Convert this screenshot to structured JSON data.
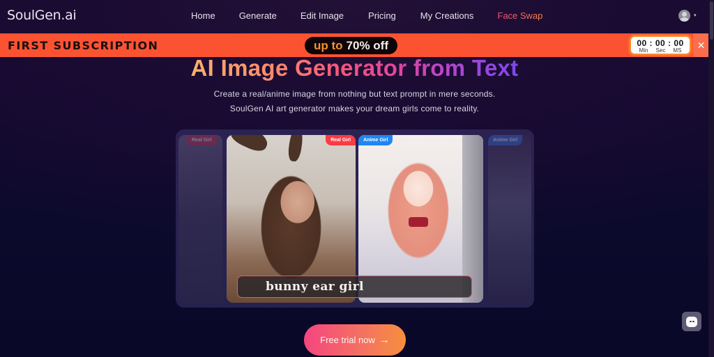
{
  "header": {
    "logo": "SoulGen.ai",
    "nav": [
      {
        "label": "Home"
      },
      {
        "label": "Generate"
      },
      {
        "label": "Edit Image"
      },
      {
        "label": "Pricing"
      },
      {
        "label": "My Creations"
      },
      {
        "label": "Face Swap",
        "highlight": true
      }
    ],
    "user_menu_caret": "▾"
  },
  "promo": {
    "title": "FIRST SUBSCRIPTION",
    "offer_prefix": "up to",
    "offer_value": "70% off",
    "timer": {
      "digits": "00 : 00 : 00",
      "labels": [
        "Min",
        "Sec",
        "MS"
      ]
    },
    "close": "✕",
    "background": "#fb5331"
  },
  "hero": {
    "title": "AI Image Generator from Text",
    "subtitle_line1": "Create a real/anime image from nothing but text prompt in mere seconds.",
    "subtitle_line2": "SoulGen AI art generator makes your dream girls come to reality."
  },
  "showcase": {
    "cards": [
      {
        "tag": "Real Girl",
        "type": "faded"
      },
      {
        "tag": "Real Girl",
        "type": "real"
      },
      {
        "tag": "Anime Girl",
        "type": "anime"
      },
      {
        "tag": "Anime Girl",
        "type": "faded"
      }
    ],
    "prompt": "bunny ear girl"
  },
  "cta": {
    "label": "Free trial now",
    "arrow": "→"
  },
  "colors": {
    "accent_pink": "#f5457f",
    "accent_orange": "#f78f3d",
    "real_tag": "#f83b45",
    "anime_tag": "#1f86f2",
    "background": "#0b0828"
  }
}
